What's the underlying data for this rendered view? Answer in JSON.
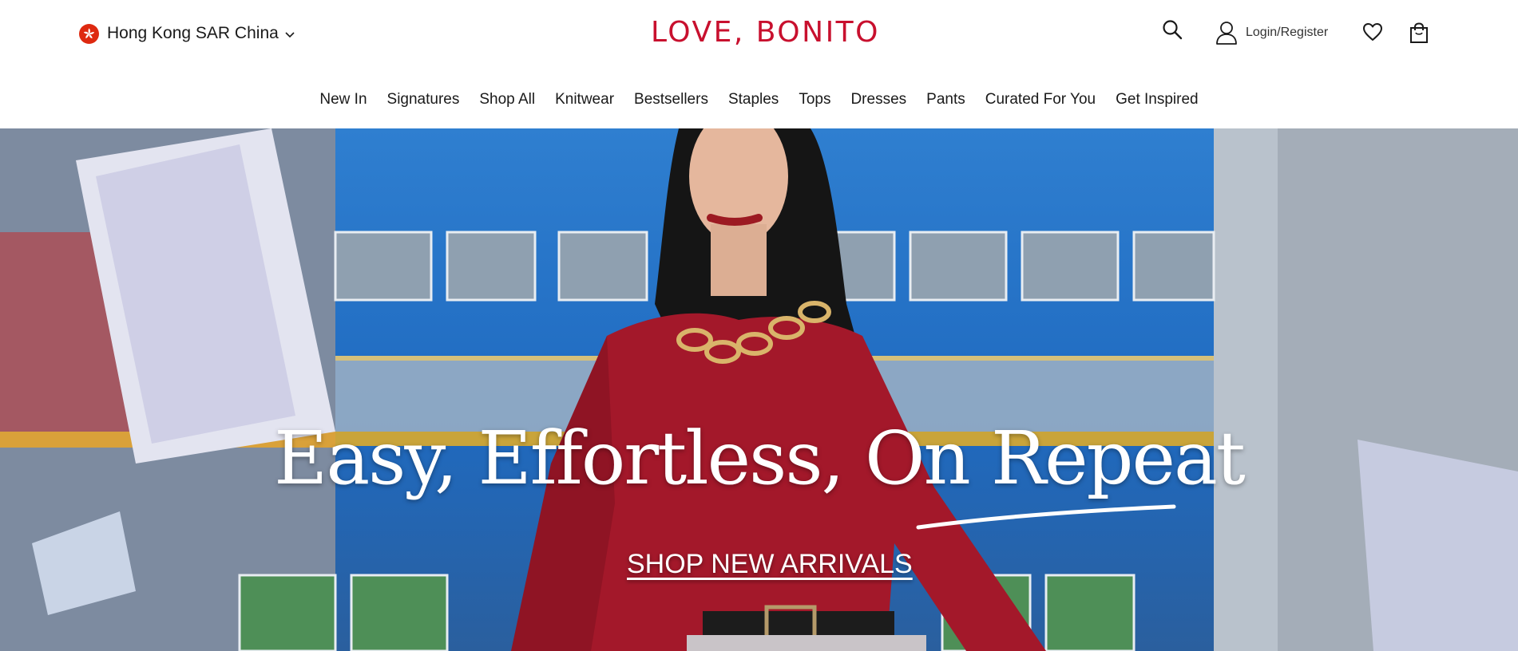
{
  "header": {
    "region": {
      "label": "Hong Kong SAR China",
      "flag": "hong-kong-flag"
    },
    "logo": "LOVE, BONITO",
    "account_label": "Login/Register",
    "icons": {
      "search": "search-icon",
      "account": "user-icon",
      "wishlist": "heart-icon",
      "bag": "shopping-bag-icon"
    },
    "brand_color": "#c8102e"
  },
  "nav": {
    "items": [
      "New In",
      "Signatures",
      "Shop All",
      "Knitwear",
      "Bestsellers",
      "Staples",
      "Tops",
      "Dresses",
      "Pants",
      "Curated For You",
      "Get Inspired"
    ]
  },
  "hero": {
    "title": "Easy, Effortless, On Repeat",
    "cta": "SHOP NEW ARRIVALS"
  }
}
